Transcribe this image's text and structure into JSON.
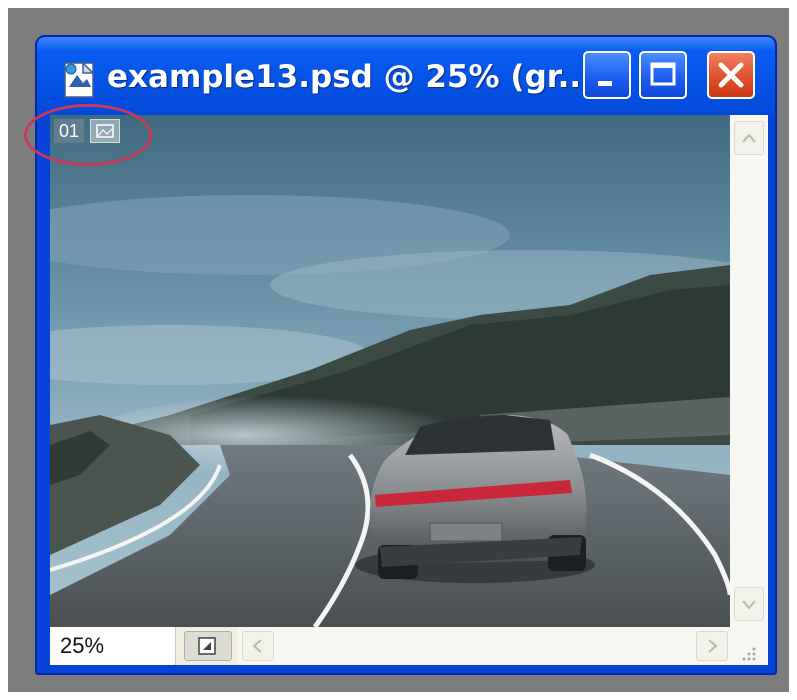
{
  "window": {
    "title": "example13.psd @ 25% (gr..."
  },
  "status": {
    "zoom": "25%"
  },
  "document": {
    "channel_label": "01"
  },
  "colors": {
    "titlebar": "#0553e6",
    "close_button": "#e0502c",
    "highlight_ring": "#c83a5a"
  },
  "icons": {
    "app": "photoshop-document-icon",
    "minimize": "minimize-icon",
    "maximize": "maximize-icon",
    "close": "close-icon",
    "channel": "image-icon",
    "status_menu": "status-menu-icon",
    "scroll_up": "chevron-up-icon",
    "scroll_down": "chevron-down-icon",
    "scroll_left": "chevron-left-icon",
    "scroll_right": "chevron-right-icon"
  }
}
